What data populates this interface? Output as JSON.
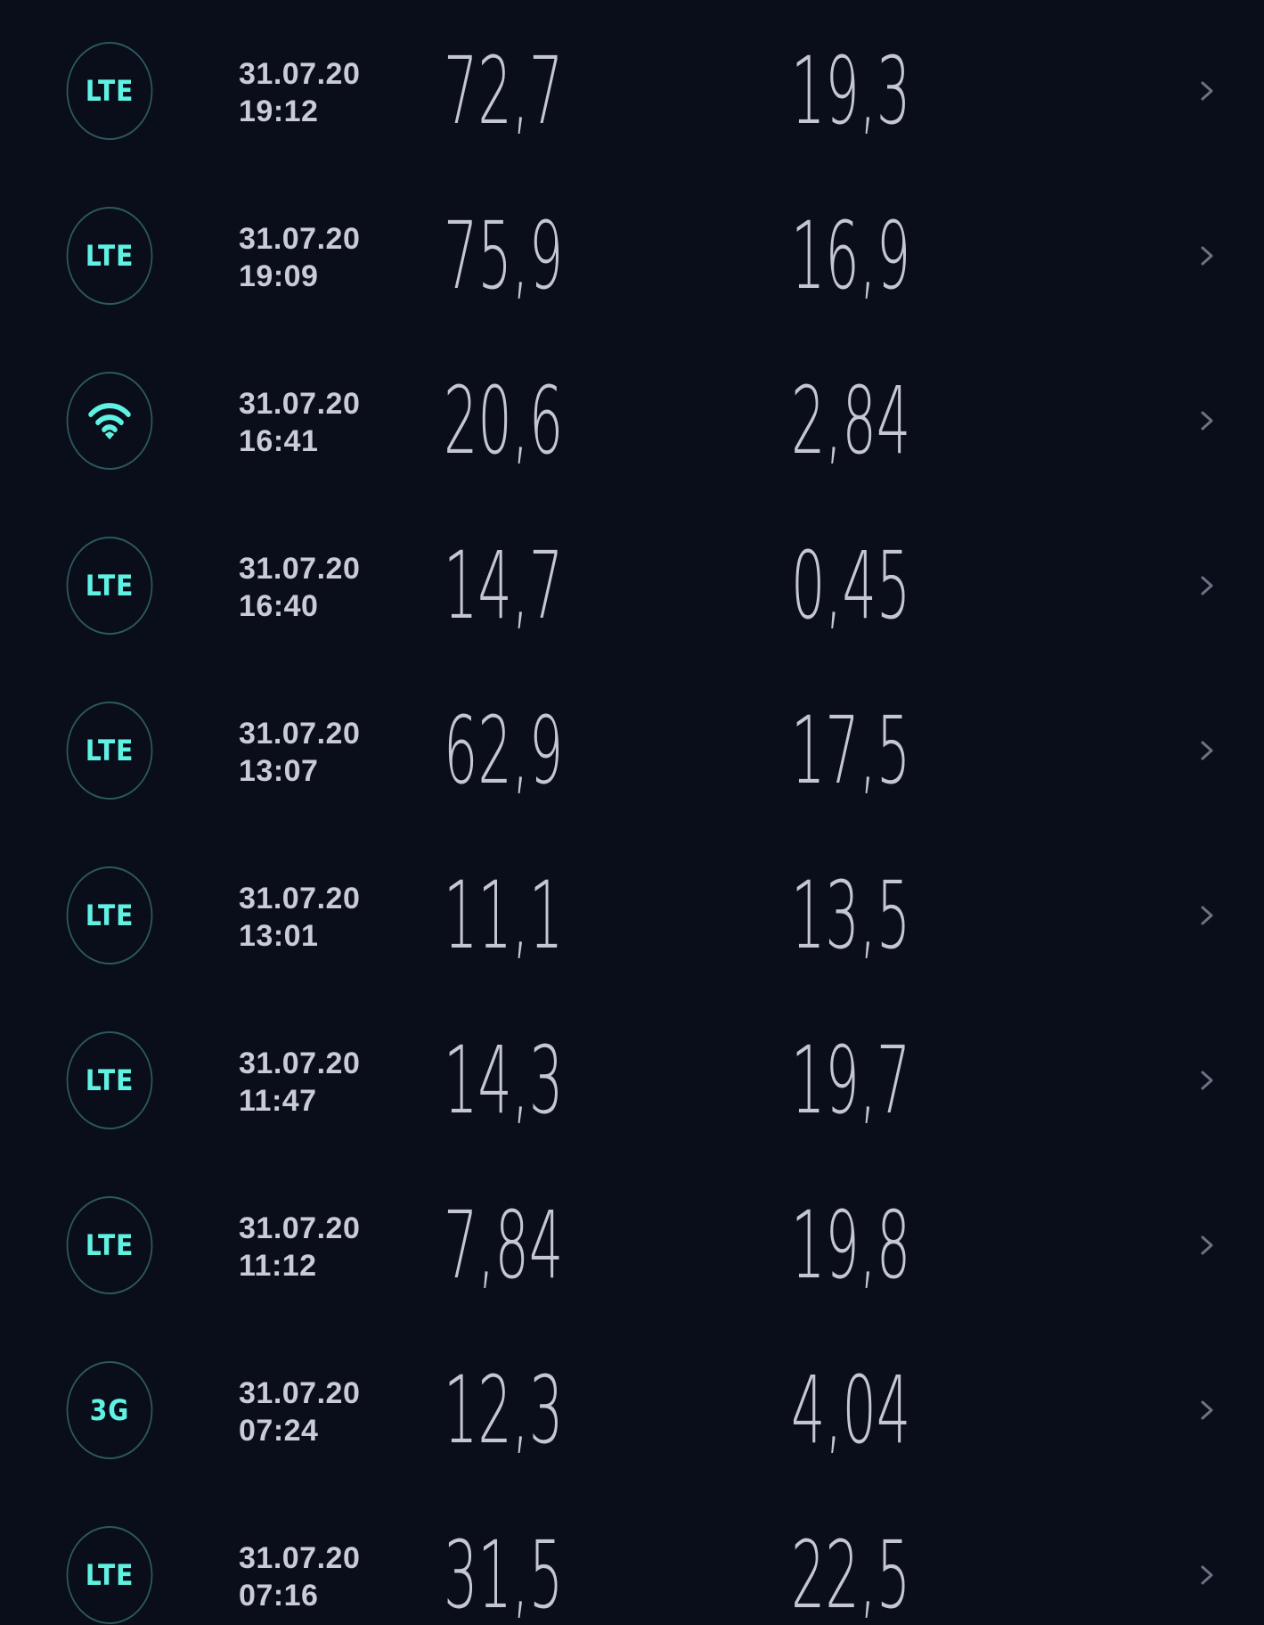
{
  "results": [
    {
      "network": "LTE",
      "date": "31.07.20",
      "time": "19:12",
      "download": "72,7",
      "upload": "19,3"
    },
    {
      "network": "LTE",
      "date": "31.07.20",
      "time": "19:09",
      "download": "75,9",
      "upload": "16,9"
    },
    {
      "network": "WIFI",
      "date": "31.07.20",
      "time": "16:41",
      "download": "20,6",
      "upload": "2,84"
    },
    {
      "network": "LTE",
      "date": "31.07.20",
      "time": "16:40",
      "download": "14,7",
      "upload": "0,45"
    },
    {
      "network": "LTE",
      "date": "31.07.20",
      "time": "13:07",
      "download": "62,9",
      "upload": "17,5"
    },
    {
      "network": "LTE",
      "date": "31.07.20",
      "time": "13:01",
      "download": "11,1",
      "upload": "13,5"
    },
    {
      "network": "LTE",
      "date": "31.07.20",
      "time": "11:47",
      "download": "14,3",
      "upload": "19,7"
    },
    {
      "network": "LTE",
      "date": "31.07.20",
      "time": "11:12",
      "download": "7,84",
      "upload": "19,8"
    },
    {
      "network": "3G",
      "date": "31.07.20",
      "time": "07:24",
      "download": "12,3",
      "upload": "4,04"
    },
    {
      "network": "LTE",
      "date": "31.07.20",
      "time": "07:16",
      "download": "31,5",
      "upload": "22,5"
    }
  ],
  "icons": {
    "wifi": "wifi-icon",
    "chevron": "chevron-right-icon"
  },
  "colors": {
    "background": "#0a0d1a",
    "accent": "#5ff2e3",
    "badge_border": "#2b5a5c",
    "text": "#c4c7d2",
    "chevron": "#6e7180"
  }
}
